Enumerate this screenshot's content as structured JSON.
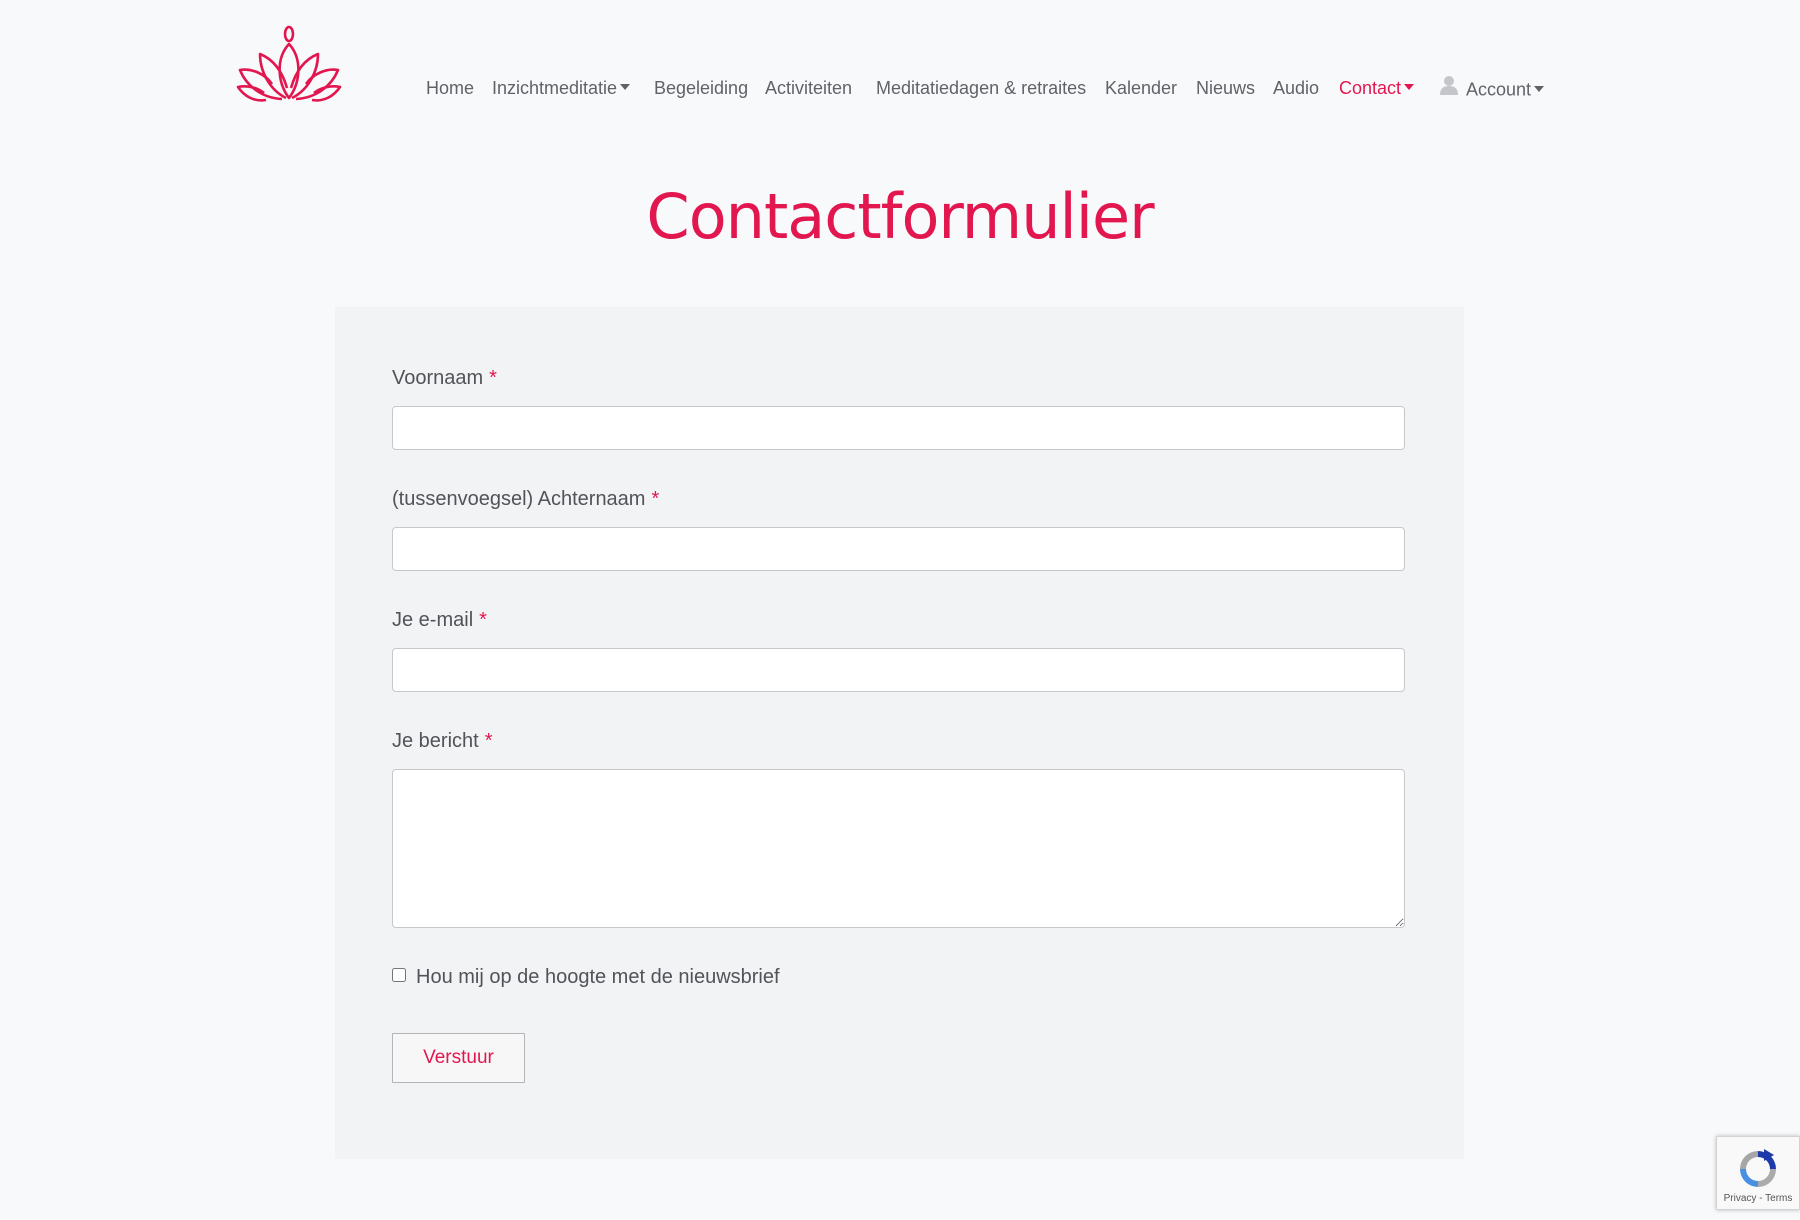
{
  "nav": {
    "items": [
      {
        "label": "Home"
      },
      {
        "label": "Inzichtmeditatie"
      },
      {
        "label": "Begeleiding"
      },
      {
        "label": "Activiteiten"
      },
      {
        "label": "Meditatiedagen & retraites"
      },
      {
        "label": "Kalender"
      },
      {
        "label": "Nieuws"
      },
      {
        "label": "Audio"
      },
      {
        "label": "Contact"
      },
      {
        "label": "Account"
      }
    ],
    "active": "Contact"
  },
  "page": {
    "title": "Contactformulier"
  },
  "form": {
    "required_marker": "*",
    "fields": [
      {
        "label": "Voornaam",
        "value": ""
      },
      {
        "label": "(tussenvoegsel) Achternaam",
        "value": ""
      },
      {
        "label": "Je e-mail",
        "value": ""
      },
      {
        "label": "Je bericht",
        "value": ""
      }
    ],
    "newsletter": {
      "label": "Hou mij op de hoogte met de nieuwsbrief",
      "checked": false
    },
    "submit_label": "Verstuur"
  },
  "recaptcha": {
    "privacy": "Privacy",
    "separator": " - ",
    "terms": "Terms"
  },
  "colors": {
    "accent": "#e2174f",
    "page_bg": "#f8f9fb",
    "panel_bg": "#f2f3f5",
    "text": "#5f6368"
  },
  "icons": {
    "logo": "lotus-logo-icon",
    "account": "user-icon",
    "dropdown": "caret-down-icon",
    "recaptcha": "recaptcha-icon"
  }
}
